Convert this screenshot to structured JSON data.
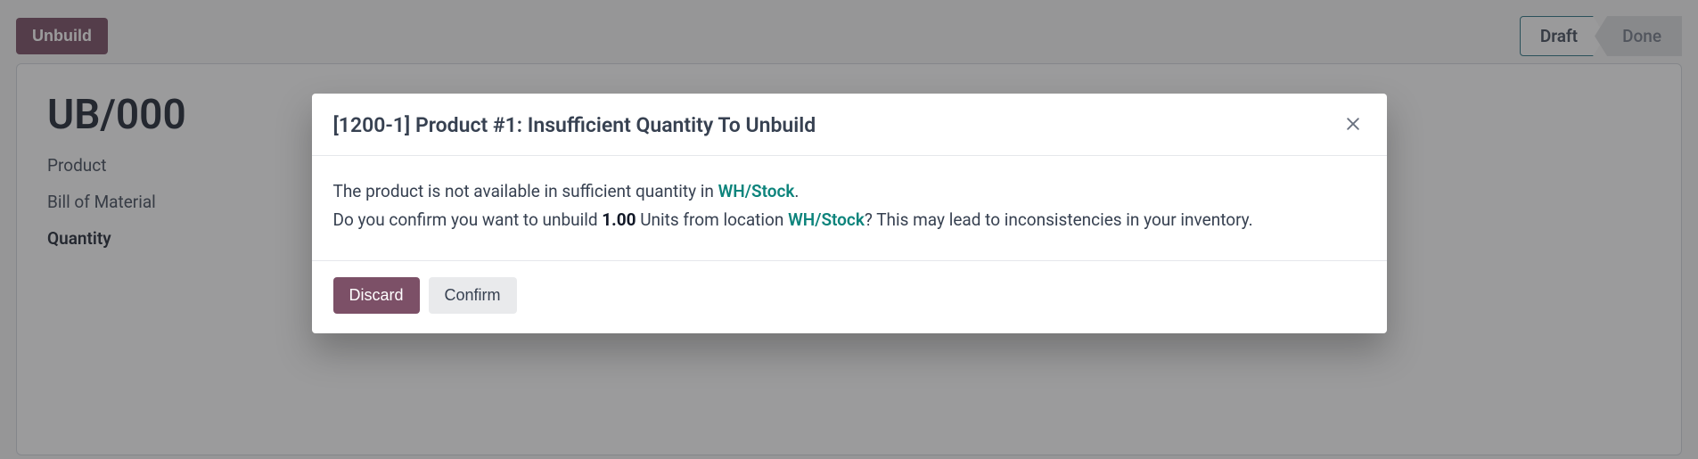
{
  "topbar": {
    "unbuild_label": "Unbuild",
    "status": {
      "draft": "Draft",
      "done": "Done"
    }
  },
  "sheet": {
    "title": "UB/000",
    "fields": {
      "product": "Product",
      "bom": "Bill of Material",
      "quantity": "Quantity"
    }
  },
  "modal": {
    "title": "[1200-1] Product #1: Insufficient Quantity To Unbuild",
    "body": {
      "line1_pre": "The product is not available in sufficient quantity in ",
      "location1": "WH/Stock",
      "line1_post": ".",
      "line2_pre": "Do you confirm you want to unbuild ",
      "qty": "1.00",
      "line2_mid": " Units from location ",
      "location2": "WH/Stock",
      "line2_post": "? This may lead to inconsistencies in your inventory."
    },
    "buttons": {
      "discard": "Discard",
      "confirm": "Confirm"
    }
  }
}
